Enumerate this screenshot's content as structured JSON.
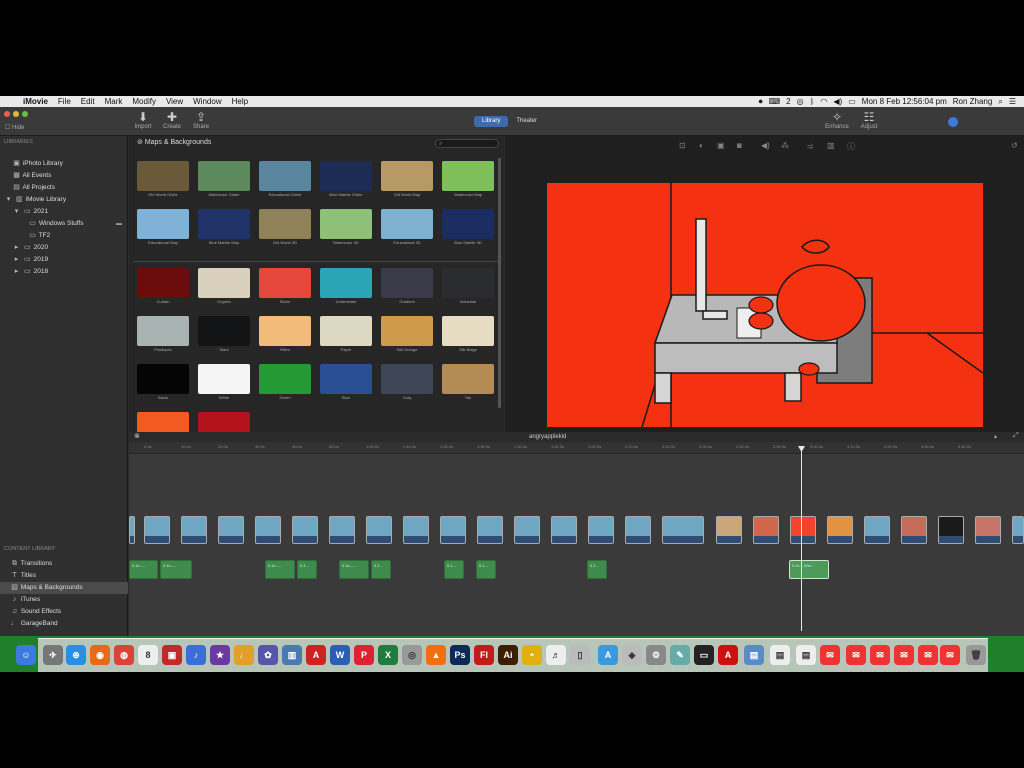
{
  "menubar": {
    "app": "iMovie",
    "items": [
      "File",
      "Edit",
      "Mark",
      "Modify",
      "View",
      "Window",
      "Help"
    ],
    "clock": "Mon 8 Feb  12:56:04 pm",
    "user": "Ron Zhang",
    "input_indicator": "2"
  },
  "toolbar": {
    "hide_label": "Hide",
    "import_label": "Import",
    "create_label": "Create",
    "share_label": "Share",
    "library_tab": "Library",
    "theater_tab": "Theater",
    "enhance_label": "Enhance",
    "adjust_label": "Adjust"
  },
  "sidebar": {
    "libraries_header": "LIBRARIES",
    "libraries": [
      {
        "label": "iPhoto Library",
        "icon": "photo-icon"
      },
      {
        "label": "All Events",
        "icon": "events-icon"
      },
      {
        "label": "All Projects",
        "icon": "projects-icon"
      },
      {
        "label": "iMovie Library",
        "icon": "library-icon"
      },
      {
        "label": "2021",
        "icon": "event-icon"
      },
      {
        "label": "Windows Stuffs",
        "icon": "event-icon"
      },
      {
        "label": "TF2",
        "icon": "event-icon"
      },
      {
        "label": "2020",
        "icon": "event-icon"
      },
      {
        "label": "2019",
        "icon": "event-icon"
      },
      {
        "label": "2018",
        "icon": "event-icon"
      }
    ],
    "content_header": "CONTENT LIBRARY",
    "content": [
      {
        "label": "Transitions",
        "icon": "transitions-icon"
      },
      {
        "label": "Titles",
        "icon": "titles-icon"
      },
      {
        "label": "Maps & Backgrounds",
        "icon": "maps-icon"
      },
      {
        "label": "iTunes",
        "icon": "music-icon"
      },
      {
        "label": "Sound Effects",
        "icon": "sound-icon"
      },
      {
        "label": "GarageBand",
        "icon": "guitar-icon"
      }
    ]
  },
  "browser": {
    "title": "Maps & Backgrounds",
    "maps": [
      {
        "label": "Old World Globe",
        "color": "#6a5a3a"
      },
      {
        "label": "Watercolor Globe",
        "color": "#5c8a5c"
      },
      {
        "label": "Educational Globe",
        "color": "#5b86a0"
      },
      {
        "label": "Blue Marble Globe",
        "color": "#1c2c55"
      },
      {
        "label": "Old World Map",
        "color": "#b79a63"
      },
      {
        "label": "Watercolor Map",
        "color": "#7fbf5a"
      },
      {
        "label": "Educational Map",
        "color": "#7fb2d6"
      },
      {
        "label": "Blue Marble Map",
        "color": "#1f3368"
      },
      {
        "label": "Old World 3D",
        "color": "#8f8158"
      },
      {
        "label": "Watercolor 3D",
        "color": "#8fc07a"
      },
      {
        "label": "Educational 3D",
        "color": "#7fb0cf"
      },
      {
        "label": "Blue Marble 3D",
        "color": "#1b2d60"
      }
    ],
    "backgrounds": [
      {
        "label": "Curtain",
        "color": "#6b0d0d"
      },
      {
        "label": "Organic",
        "color": "#d8d0bd"
      },
      {
        "label": "Blobs",
        "color": "#e4483a"
      },
      {
        "label": "Underwater",
        "color": "#2aa5b8"
      },
      {
        "label": "Gradient",
        "color": "#3a3a48"
      },
      {
        "label": "Industrial",
        "color": "#2a2c30"
      },
      {
        "label": "Pinstripes",
        "color": "#a9b4b2"
      },
      {
        "label": "Stars",
        "color": "#121416"
      },
      {
        "label": "Retro",
        "color": "#f2bb7a"
      },
      {
        "label": "Paper",
        "color": "#dcd8c2"
      },
      {
        "label": "Silk Orange",
        "color": "#d09a4b"
      },
      {
        "label": "Silk Beige",
        "color": "#e5dcc3"
      },
      {
        "label": "Black",
        "color": "#050505"
      },
      {
        "label": "White",
        "color": "#f5f5f5"
      },
      {
        "label": "Green",
        "color": "#249a35"
      },
      {
        "label": "Blue",
        "color": "#2b4f94"
      },
      {
        "label": "Gray",
        "color": "#3f4656"
      },
      {
        "label": "Tan",
        "color": "#b48a55"
      },
      {
        "label": "",
        "color": "#f25a22"
      },
      {
        "label": "",
        "color": "#b3141c"
      }
    ]
  },
  "timeline": {
    "project_title": "angryapplekid",
    "ticks": [
      "0.0s",
      "10.0s",
      "20.0s",
      "30.0s",
      "40.0s",
      "50.0s",
      "1:00.0s",
      "1:10.0s",
      "1:20.0s",
      "1:30.0s",
      "1:40.0s",
      "1:50.0s",
      "2:00.0s",
      "2:10.0s",
      "2:20.0s",
      "2:30.0s",
      "2:40.0s",
      "2:50.0s",
      "3:00.0s",
      "3:10.0s",
      "3:20.0s",
      "3:30.0s",
      "3:40.0s"
    ],
    "audio_clips": [
      "0.1s –…",
      "0.1s –…",
      "0.1s –…",
      "0.1…",
      "0.1s –…",
      "0.1…",
      "0.1…",
      "0.1…",
      "0.1…",
      "0.2s – Wei…"
    ]
  },
  "colors": {
    "accent": "#3d6aa8",
    "preview_bg": "#f43111",
    "dock_bg": "#1f7f2a"
  }
}
